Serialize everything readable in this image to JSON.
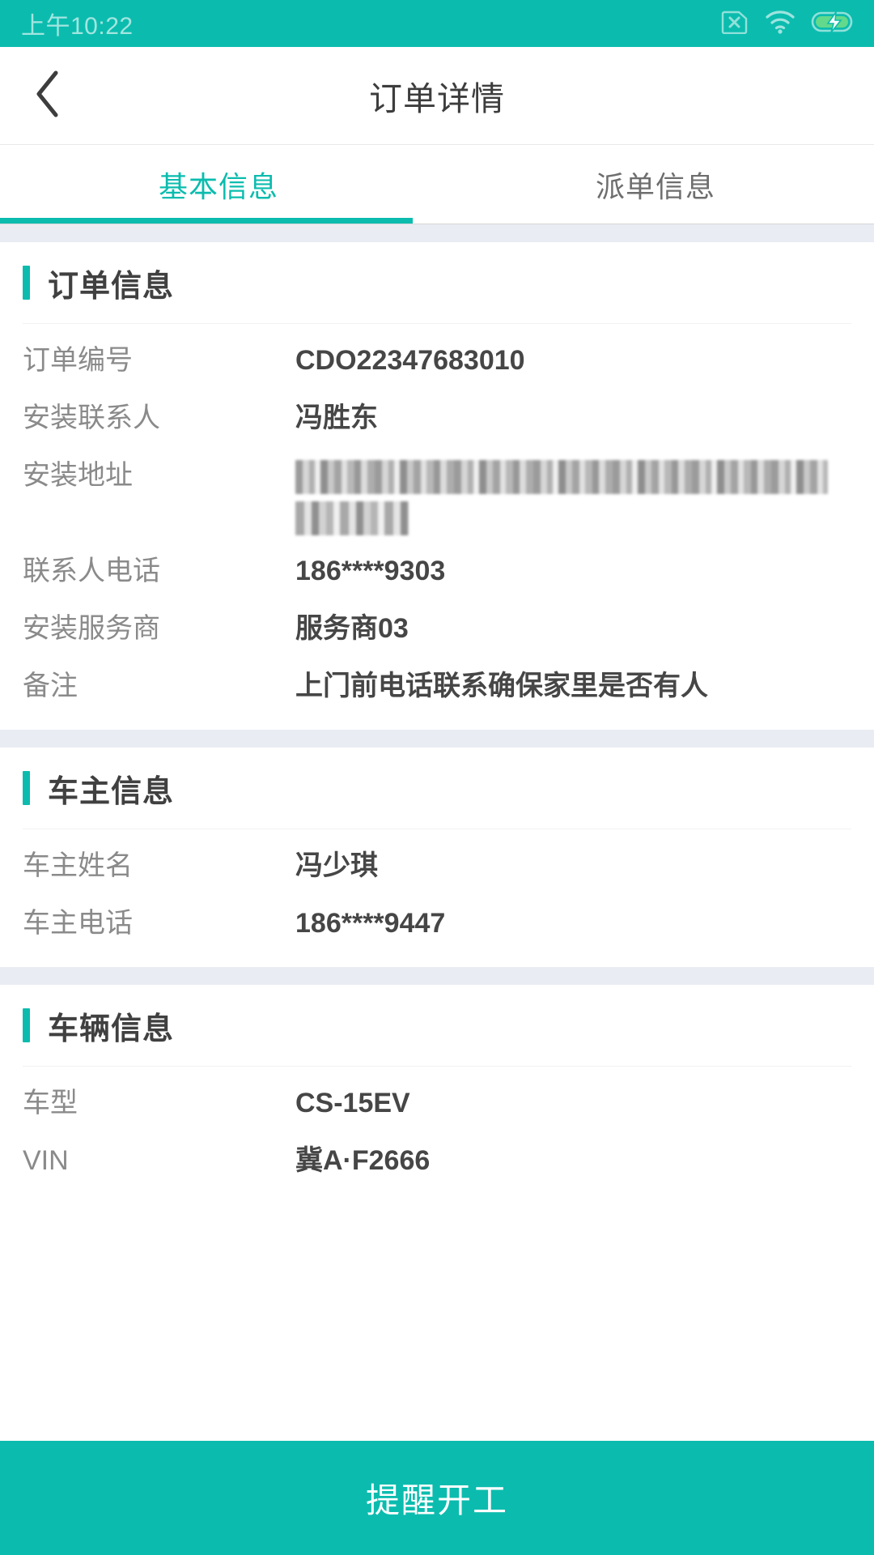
{
  "statusbar": {
    "time": "上午10:22",
    "icons": [
      "sim-card-disabled-icon",
      "wifi-icon",
      "battery-charging-icon"
    ]
  },
  "navbar": {
    "title": "订单详情",
    "back_icon": "chevron-left-icon"
  },
  "tabs": [
    {
      "label": "基本信息",
      "active": true
    },
    {
      "label": "派单信息",
      "active": false
    }
  ],
  "sections": [
    {
      "title": "订单信息",
      "rows": [
        {
          "label": "订单编号",
          "value": "CDO22347683010"
        },
        {
          "label": "安装联系人",
          "value": "冯胜东"
        },
        {
          "label": "安装地址",
          "value": "",
          "redacted": true
        },
        {
          "label": "联系人电话",
          "value": "186****9303"
        },
        {
          "label": "安装服务商",
          "value": "服务商03"
        },
        {
          "label": "备注",
          "value": "上门前电话联系确保家里是否有人"
        }
      ]
    },
    {
      "title": "车主信息",
      "rows": [
        {
          "label": "车主姓名",
          "value": "冯少琪"
        },
        {
          "label": "车主电话",
          "value": "186****9447"
        }
      ]
    },
    {
      "title": "车辆信息",
      "rows": [
        {
          "label": "车型",
          "value": "CS-15EV"
        },
        {
          "label": "VIN",
          "value": "冀A·F2666"
        }
      ]
    }
  ],
  "bottom_action": {
    "label": "提醒开工"
  },
  "colors": {
    "accent": "#0bbcae",
    "band": "#eaecf4",
    "label_text": "#8a8a8a",
    "value_text": "#464646",
    "title_text": "#404040"
  }
}
